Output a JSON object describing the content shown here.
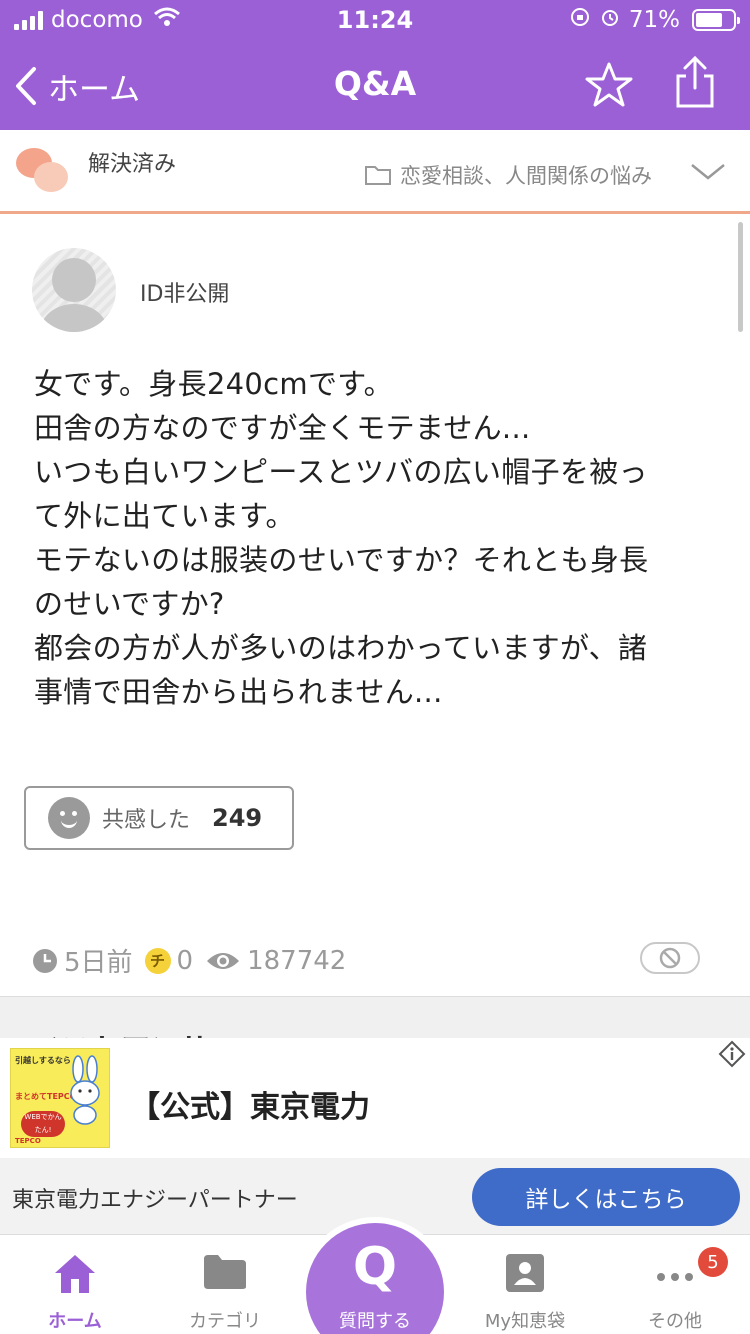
{
  "status_bar": {
    "carrier": "docomo",
    "time": "11:24",
    "battery": "71%",
    "battery_level": 0.71
  },
  "nav": {
    "back_label": "ホーム",
    "title": "Q&A"
  },
  "meta": {
    "status": "解決済み",
    "category": "恋愛相談、人間関係の悩み"
  },
  "question": {
    "user": "ID非公開",
    "lines": [
      "女です。身長240cmです。",
      "田舎の方なのですが全くモテません...",
      "いつも白いワンピースとツバの広い帽子を被っ",
      "て外に出ています。",
      "モテないのは服装のせいですか？それとも身長",
      "のせいですか?",
      "都会の方が人が多いのはわかっていますが、諸",
      "事情で田舎から出られません..."
    ],
    "empathy_label": "共感した",
    "empathy_count": "249",
    "posted": "5日前",
    "coins": "0",
    "views": "187742"
  },
  "hidden_section": {
    "partial_heading": "ベストアンサー"
  },
  "ad": {
    "thumb_text_top": "引越しするなら",
    "thumb_text_mid": "まとめてTEPCOへ!",
    "thumb_pill": "WEBでかんたん!",
    "thumb_logo": "TEPCO",
    "title": "【公式】東京電力",
    "sponsor": "東京電力エナジーパートナー",
    "cta": "詳しくはこちら"
  },
  "tabbar": {
    "home": "ホーム",
    "category": "カテゴリ",
    "ask_symbol": "Q",
    "ask": "質問する",
    "my": "My知恵袋",
    "other": "その他",
    "other_badge": "5"
  },
  "colors": {
    "brand_purple": "#9b5fd6",
    "ask_purple": "#a973dc",
    "accent_orange": "#f0a88a",
    "cta_blue": "#3f6bc9",
    "badge_red": "#e24a3b"
  }
}
